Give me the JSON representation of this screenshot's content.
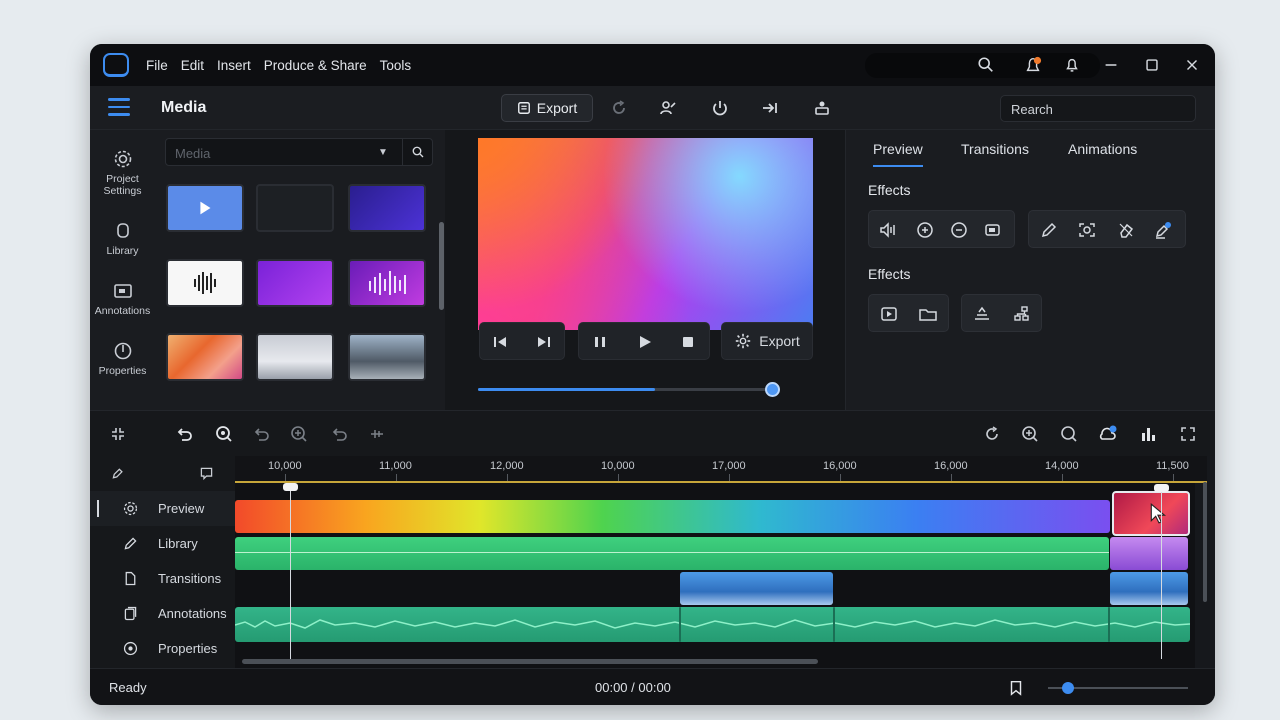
{
  "menu": [
    "File",
    "Edit",
    "Insert",
    "Produce & Share",
    "Tools"
  ],
  "toolbar": {
    "title": "Media",
    "export_label": "Export",
    "search_value": "Rearch"
  },
  "rail": [
    {
      "label": "Project Settings",
      "icon": "gear-icon"
    },
    {
      "label": "Library",
      "icon": "library-icon"
    },
    {
      "label": "Annotations",
      "icon": "annotation-icon"
    },
    {
      "label": "Properties",
      "icon": "power-icon"
    }
  ],
  "media": {
    "search_placeholder": "Media"
  },
  "player": {
    "progress": 0.6,
    "export_label": "Export"
  },
  "right_panel": {
    "tabs": [
      "Preview",
      "Transitions",
      "Animations"
    ],
    "active_tab": "Preview",
    "section1": "Effects",
    "section2": "Effects"
  },
  "timeline": {
    "ruler": [
      "10,000",
      "11,000",
      "12,000",
      "10,000",
      "17,000",
      "16,000",
      "16,000",
      "14,000",
      "11,500"
    ],
    "tracks": [
      "Preview",
      "Library",
      "Transitions",
      "Annotations",
      "Properties"
    ]
  },
  "status": {
    "left": "Ready",
    "time": "00:00 / 00:00",
    "zoom": 0.17
  }
}
